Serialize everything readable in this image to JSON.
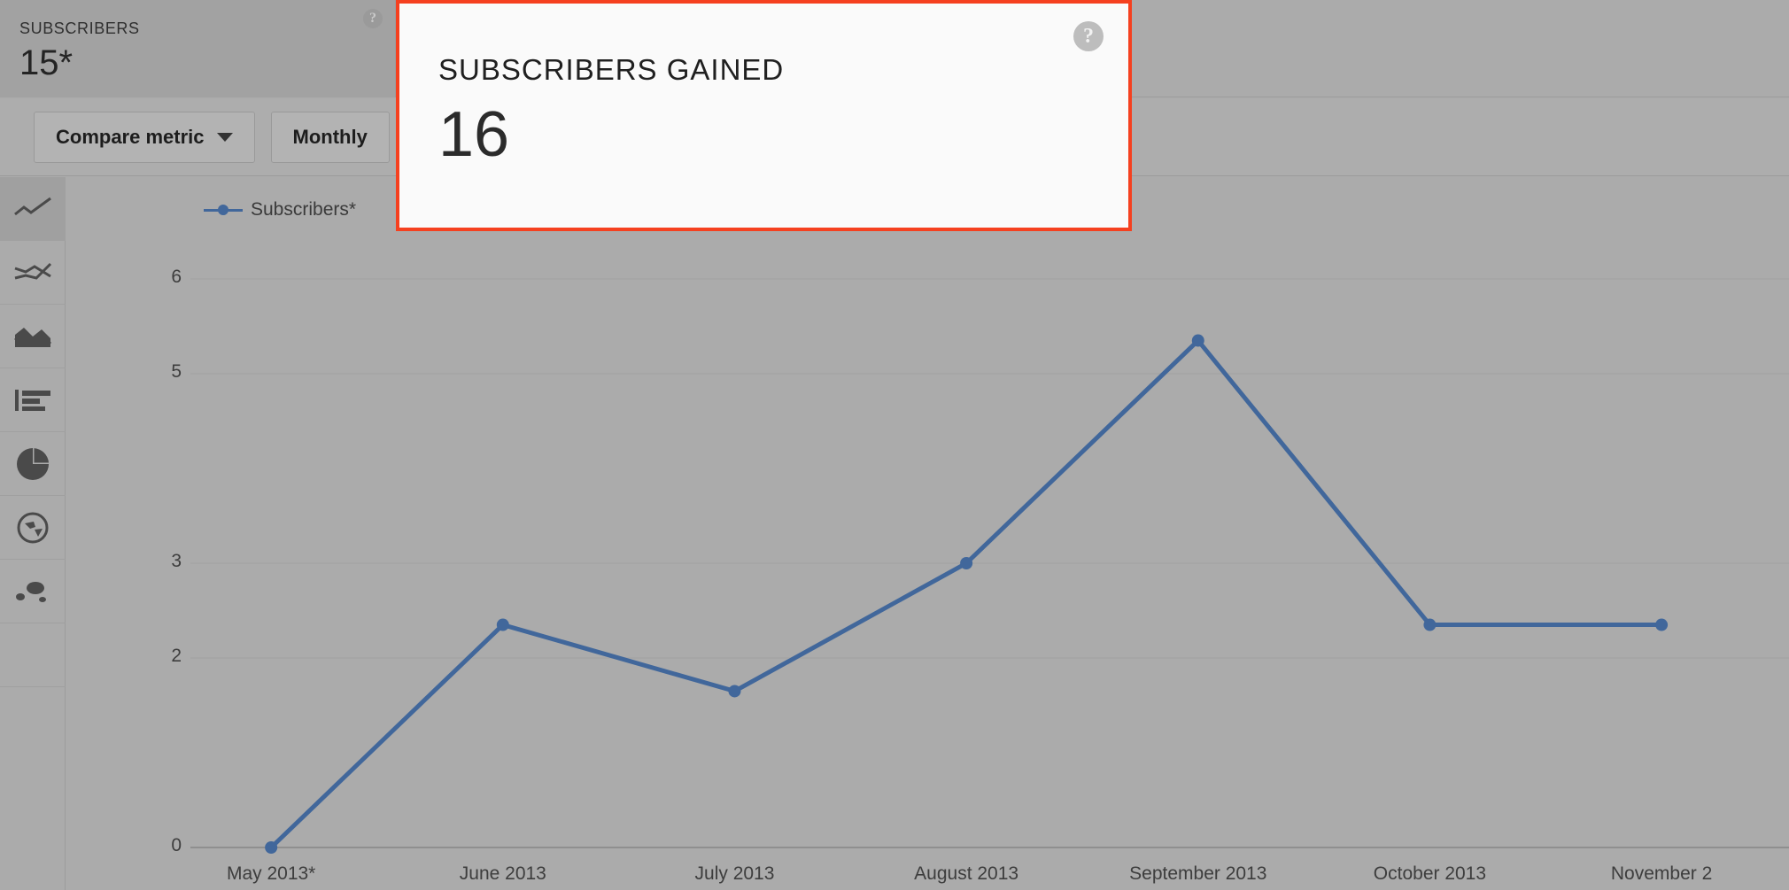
{
  "metric_strip": {
    "cards": [
      {
        "label": "SUBSCRIBERS",
        "value": "15*",
        "help": "?",
        "selected": true
      },
      {
        "label": "",
        "value": "",
        "help": "?",
        "selected": false
      },
      {
        "label": "",
        "value": "",
        "help": "",
        "selected": false
      }
    ]
  },
  "toolbar": {
    "compare_metric_label": "Compare metric",
    "period_label": "Monthly"
  },
  "chart_rail": {
    "items": [
      {
        "name": "line-chart-icon",
        "active": true
      },
      {
        "name": "multi-line-chart-icon",
        "active": false
      },
      {
        "name": "area-chart-icon",
        "active": false
      },
      {
        "name": "bar-chart-icon",
        "active": false
      },
      {
        "name": "pie-chart-icon",
        "active": false
      },
      {
        "name": "geo-map-icon",
        "active": false
      },
      {
        "name": "bubble-chart-icon",
        "active": false
      }
    ]
  },
  "highlight_card": {
    "label": "SUBSCRIBERS GAINED",
    "value": "16",
    "help": "?",
    "border_color": "#f5401f"
  },
  "chart_data": {
    "type": "line",
    "title": "",
    "xlabel": "",
    "ylabel": "",
    "legend": [
      "Subscribers*"
    ],
    "legend_position": "top-left",
    "grid": true,
    "series_color": "#41679b",
    "categories": [
      "May 2013*",
      "June 2013",
      "July 2013",
      "August 2013",
      "September 2013",
      "October 2013",
      "November 2"
    ],
    "series": [
      {
        "name": "Subscribers*",
        "values": [
          0,
          2.35,
          1.65,
          3.0,
          5.35,
          2.35,
          2.35
        ]
      }
    ],
    "ytick_labels": [
      "6",
      "5",
      "3",
      "2",
      "0"
    ],
    "ytick_values": [
      6,
      5,
      3,
      2,
      0
    ],
    "ylim": [
      0,
      6.4
    ]
  }
}
